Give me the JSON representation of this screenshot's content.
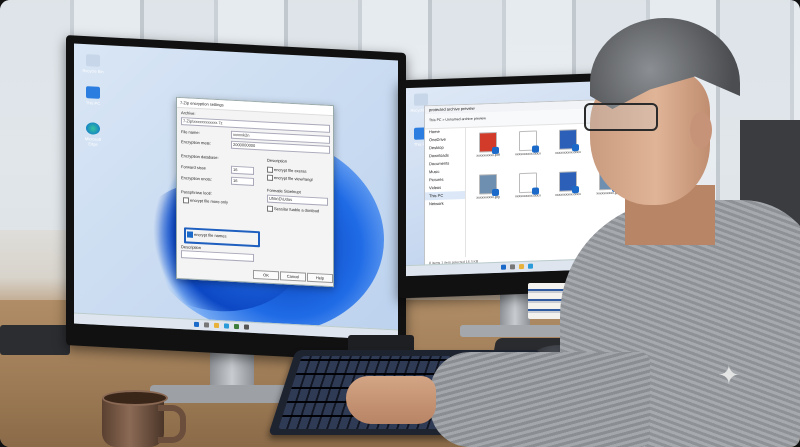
{
  "left_screen": {
    "desktop_icons": [
      "Recycle Bin",
      "This PC",
      "Microsoft Edge"
    ],
    "dialog": {
      "title": "7-Zip encryption settings",
      "archive_label": "Archive:",
      "archive_value": "7-Zip\\xxxxxxxxxxxx.7z",
      "filename_label": "File name:",
      "filename_value": "xxxxxk2n",
      "enc_method_label": "Encryption mete:",
      "enc_method_value": "2000000000",
      "enc_db_label": "Encryption database:",
      "forward_label": "Forward sisse",
      "forward_value": "16",
      "enc_ends_label": "Encryption enots:",
      "enc_ends_value": "16",
      "desc_heading": "Description",
      "opt_1": "encrypt file exeras",
      "opt_2": "encrypt file view/rangl",
      "passphrase_label": "Passphrase lootl:",
      "opt_3": "encrypt file more only",
      "opt_4": "encrypt file names",
      "footer_label": "Formatie Stoelnupt",
      "footer_value": "Ufilix\\D\\Udas",
      "opt_5": "Sessilar fuable a dontbud",
      "desc_label": "Description",
      "ok": "OK",
      "cancel": "Cancel",
      "help": "Help"
    }
  },
  "right_screen": {
    "desktop_icons": [
      "Recycle Bin",
      "This PC"
    ],
    "explorer": {
      "title": "protected archive preview",
      "breadcrumb": "This PC  >  Unnamed archive preview",
      "sidebar": [
        "Home",
        "OneDrive",
        "Desktop",
        "Downloads",
        "Documents",
        "Music",
        "Pictures",
        "Videos",
        "This PC",
        "Network"
      ],
      "files": [
        {
          "name": "xxxxxxxxxx.pdf",
          "kind": "pdf"
        },
        {
          "name": "xxxxxxxxxx.docx",
          "kind": "generic"
        },
        {
          "name": "xxxxxxxxxx.docx",
          "kind": "word"
        },
        {
          "name": "xxxxxxxxxx.jpg",
          "kind": "image"
        },
        {
          "name": "xxxxxxxxxx.jpg",
          "kind": "image"
        },
        {
          "name": "xxxxxxxxxx.docx",
          "kind": "generic"
        },
        {
          "name": "xxxxxxxxxx.docx",
          "kind": "word"
        },
        {
          "name": "xxxxxxxxxx.jpg",
          "kind": "image"
        }
      ],
      "status": "8 items    1 item selected    16.3 KB"
    }
  },
  "colors": {
    "accent_blue": "#1b6ac9",
    "highlight_border": "#1e5fbf",
    "pdf_red": "#d23b2a"
  }
}
